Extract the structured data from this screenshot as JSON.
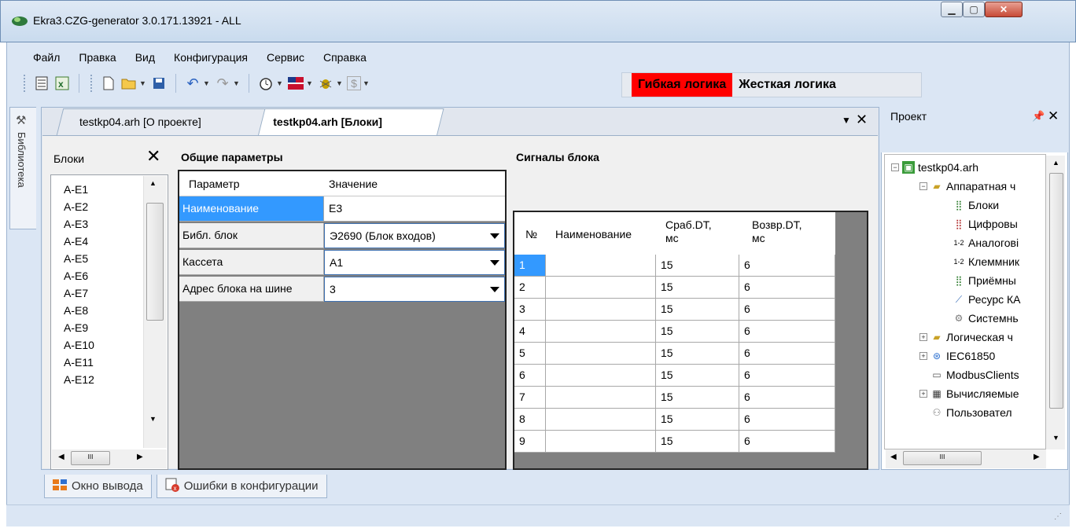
{
  "window": {
    "title": "Ekra3.CZG-generator 3.0.171.13921 - ALL",
    "min_icon": "minimize-icon",
    "max_icon": "maximize-icon",
    "close_icon": "close-icon"
  },
  "menu": [
    "Файл",
    "Правка",
    "Вид",
    "Конфигурация",
    "Сервис",
    "Справка"
  ],
  "toolbar": {
    "icons": [
      "grid-icon",
      "excel-icon",
      "new-file-icon",
      "open-folder-icon",
      "save-icon",
      "undo-icon",
      "redo-icon",
      "timer-icon",
      "flag-icon",
      "bug-icon",
      "dollar-icon"
    ]
  },
  "logic": {
    "flexible": "Гибкая логика",
    "hard": "Жесткая логика",
    "flexible_color": "#ff0000"
  },
  "library_tab": "Библиотека",
  "tabs": [
    {
      "label": "testkp04.arh [О проекте]"
    },
    {
      "label": "testkp04.arh [Блоки]"
    }
  ],
  "blocks": {
    "title": "Блоки",
    "items": [
      "A-E1",
      "A-E2",
      "A-E3",
      "A-E4",
      "A-E5",
      "A-E6",
      "A-E7",
      "A-E8",
      "A-E9",
      "A-E10",
      "A-E11",
      "A-E12"
    ]
  },
  "params": {
    "title": "Общие параметры",
    "col_param": "Параметр",
    "col_value": "Значение",
    "rows": [
      {
        "key": "Наименование",
        "value": "E3"
      },
      {
        "key": "Библ. блок",
        "value": "Э2690 (Блок входов)"
      },
      {
        "key": "Кассета",
        "value": "A1"
      },
      {
        "key": "Адрес блока на шине",
        "value": "3"
      }
    ]
  },
  "signals": {
    "title": "Сигналы блока",
    "col_n": "№",
    "col_name": "Наименование",
    "col_trip": "Сраб.DT,\nмс",
    "col_ret": "Возвр.DT,\nмс",
    "rows": [
      {
        "n": "1",
        "name": "",
        "trip": "15",
        "ret": "6"
      },
      {
        "n": "2",
        "name": "",
        "trip": "15",
        "ret": "6"
      },
      {
        "n": "3",
        "name": "",
        "trip": "15",
        "ret": "6"
      },
      {
        "n": "4",
        "name": "",
        "trip": "15",
        "ret": "6"
      },
      {
        "n": "5",
        "name": "",
        "trip": "15",
        "ret": "6"
      },
      {
        "n": "6",
        "name": "",
        "trip": "15",
        "ret": "6"
      },
      {
        "n": "7",
        "name": "",
        "trip": "15",
        "ret": "6"
      },
      {
        "n": "8",
        "name": "",
        "trip": "15",
        "ret": "6"
      },
      {
        "n": "9",
        "name": "",
        "trip": "15",
        "ret": "6"
      }
    ]
  },
  "project": {
    "title": "Проект",
    "tree": [
      {
        "label": "testkp04.arh",
        "icon": "project-icon"
      },
      {
        "label": "Аппаратная ч",
        "icon": "folder-icon"
      },
      {
        "label": "Блоки",
        "icon": "blocks-icon"
      },
      {
        "label": "Цифровы",
        "icon": "digital-icon"
      },
      {
        "label": "Аналогові",
        "icon": "analog-icon"
      },
      {
        "label": "Клеммник",
        "icon": "terminal-icon"
      },
      {
        "label": "Приёмны",
        "icon": "receiver-icon"
      },
      {
        "label": "Ресурс КА",
        "icon": "resource-icon"
      },
      {
        "label": "Системнь",
        "icon": "system-gear-icon"
      },
      {
        "label": "Логическая ч",
        "icon": "folder-icon"
      },
      {
        "label": "IEC61850",
        "icon": "iec-icon"
      },
      {
        "label": "ModbusClients",
        "icon": "modbus-icon"
      },
      {
        "label": "Вычисляемые",
        "icon": "calculator-icon"
      },
      {
        "label": "Пользовател",
        "icon": "user-icon"
      }
    ]
  },
  "bottom_tabs": [
    {
      "label": "Окно вывода",
      "icon": "output-window-icon"
    },
    {
      "label": "Ошибки в конфигурации",
      "icon": "config-errors-icon"
    }
  ]
}
